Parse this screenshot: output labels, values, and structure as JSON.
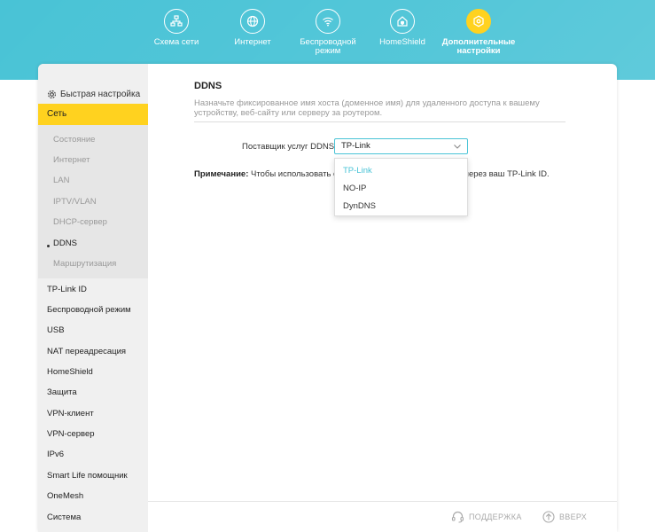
{
  "nav": {
    "items": [
      {
        "label": "Схема сети"
      },
      {
        "label": "Интернет"
      },
      {
        "label": "Беспроводной режим"
      },
      {
        "label": "HomeShield"
      },
      {
        "label": "Дополнительные настройки"
      }
    ],
    "active_index": 4
  },
  "sidebar": {
    "quick_setup": "Быстрая настройка",
    "active_section": "Сеть",
    "sub_items": [
      "Состояние",
      "Интернет",
      "LAN",
      "IPTV/VLAN",
      "DHCP-сервер",
      "DDNS",
      "Маршрутизация"
    ],
    "current_sub": "DDNS",
    "items": [
      "TP-Link ID",
      "Беспроводной режим",
      "USB",
      "NAT переадресация",
      "HomeShield",
      "Защита",
      "VPN-клиент",
      "VPN-сервер",
      "IPv6",
      "Smart Life помощник",
      "OneMesh",
      "Система"
    ]
  },
  "main": {
    "title": "DDNS",
    "description": "Назначьте фиксированное имя хоста (доменное имя) для удаленного доступа к вашему устройству, веб-сайту или серверу за роутером.",
    "provider_label": "Поставщик услуг DDNS:",
    "provider_value": "TP-Link",
    "note_label": "Примечание:",
    "note_text_left": "Чтобы использовать слу",
    "note_text_right": "через ваш TP-Link ID.",
    "dropdown_options": [
      "TP-Link",
      "NO-IP",
      "DynDNS"
    ],
    "dropdown_selected": "TP-Link"
  },
  "footer": {
    "support": "ПОДДЕРЖКА",
    "top": "ВВЕРХ"
  },
  "colors": {
    "accent": "#49c3d6",
    "active_yellow": "#ffd21f"
  }
}
